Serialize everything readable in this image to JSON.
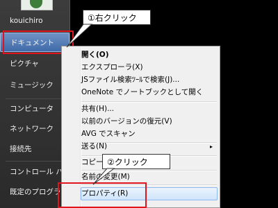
{
  "sidebar": {
    "user_name": "kouichiro",
    "items": [
      {
        "label": "ドキュメント",
        "selected": true
      },
      {
        "label": "ピクチャ"
      },
      {
        "label": "ミュージック"
      },
      {
        "label": "コンピュータ"
      },
      {
        "label": "ネットワーク"
      },
      {
        "label": "接続先"
      },
      {
        "label": "コントロール パネ"
      },
      {
        "label": "既定のプログラム"
      }
    ]
  },
  "context_menu": {
    "groups": [
      [
        {
          "label": "開く(O)",
          "bold": true
        },
        {
          "label": "エクスプローラ(X)"
        },
        {
          "label": "JSファイル検索ﾂｰﾙで検索(J)..."
        },
        {
          "label": "OneNote でノートブックとして開く"
        }
      ],
      [
        {
          "label": "共有(H)..."
        },
        {
          "label": "以前のバージョンの復元(V)"
        },
        {
          "label": "AVG でスキャン"
        }
      ],
      [
        {
          "label": "送る(N)",
          "submenu": true
        }
      ],
      [
        {
          "label": "コピー(C)"
        }
      ],
      [
        {
          "label": "名前の変更(M)"
        }
      ],
      [
        {
          "label": "プロパティ(R)",
          "highlighted": true
        }
      ]
    ],
    "submenu_arrow": "▸"
  },
  "callouts": {
    "step1": "①右クリック",
    "step2": "②クリック"
  },
  "colors": {
    "highlight_red": "#e0141d",
    "selected_item_blue": "#3f6aa8"
  }
}
